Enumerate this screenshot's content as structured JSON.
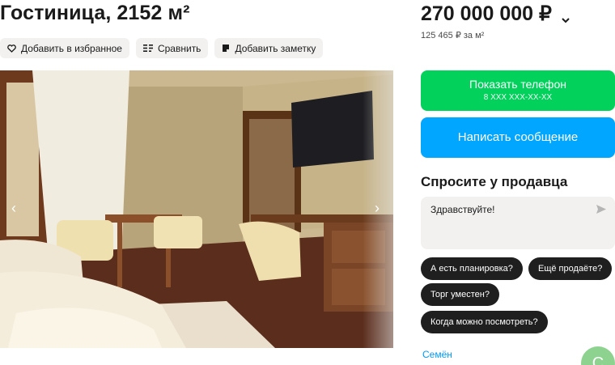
{
  "listing": {
    "title": "Гостиница, 2152 м²"
  },
  "actions": {
    "favorite": "Добавить в избранное",
    "compare": "Сравнить",
    "note": "Добавить заметку"
  },
  "gallery": {
    "prev_icon": "chevron-left-icon",
    "next_icon": "chevron-right-icon"
  },
  "price": {
    "value": "270 000 000 ₽",
    "per_m2": "125 465 ₽ за м²"
  },
  "contact": {
    "phone_label": "Показать телефон",
    "phone_masked": "8 XXX XXX-XX-XX",
    "message_label": "Написать сообщение"
  },
  "ask_seller": {
    "title": "Спросите у продавца",
    "message_value": "Здравствуйте!",
    "quick_questions": [
      "А есть планировка?",
      "Ещё продаёте?",
      "Торг уместен?",
      "Когда можно посмотреть?"
    ]
  },
  "seller": {
    "name": "Семён",
    "avatar_letter": "С"
  },
  "colors": {
    "phone_button": "#02d15c",
    "message_button": "#00a6ff",
    "chip": "#1f1f1f",
    "seller_link": "#0099f7"
  }
}
